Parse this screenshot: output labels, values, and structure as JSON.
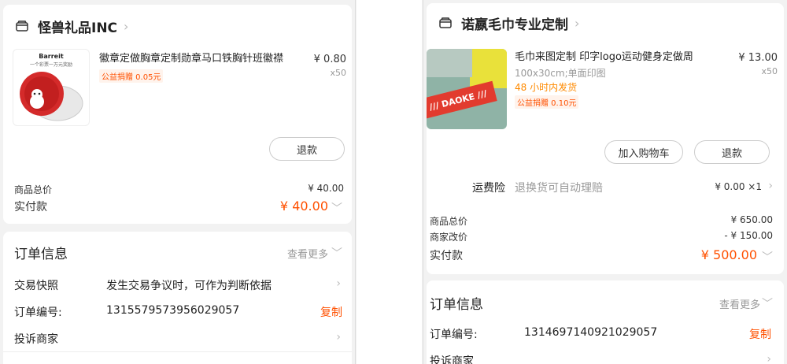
{
  "left": {
    "shop": {
      "name": "怪兽礼品INC"
    },
    "product": {
      "title": "徽章定做胸章定制勋章马口铁胸针班徽襟",
      "price": "¥ 0.80",
      "qty": "x50",
      "charity": "公益捐赠 0.05元",
      "thumb_brand": "Barreit",
      "thumb_slogan": "一个彩票一万元奖励"
    },
    "refund_button": "退款",
    "totals": {
      "goods_label": "商品总价",
      "goods_value": "¥ 40.00",
      "paid_label": "实付款",
      "paid_value": "¥ 40.00"
    },
    "order_info": {
      "title": "订单信息",
      "more": "查看更多",
      "rows": [
        {
          "label": "交易快照",
          "value": "发生交易争议时，可作为判断依据"
        },
        {
          "label": "订单编号:",
          "value": "1315579573956029057",
          "action": "复制"
        },
        {
          "label": "投诉商家",
          "value": ""
        }
      ]
    }
  },
  "right": {
    "shop": {
      "name": "诺嬴毛巾专业定制"
    },
    "product": {
      "title": "毛巾来图定制 印字logo运动健身定做周",
      "price": "¥ 13.00",
      "qty": "x50",
      "spec": "100x30cm;单面印图",
      "ship": "48 小时内发货",
      "charity": "公益捐赠 0.10元",
      "thumb_text": "/// DAOKE ///"
    },
    "add_cart_button": "加入购物车",
    "refund_button": "退款",
    "insurance": {
      "label": "运费险",
      "desc": "退换货可自动理赔",
      "value": "¥ 0.00 ×1"
    },
    "totals": {
      "goods_label": "商品总价",
      "goods_value": "¥ 650.00",
      "adjust_label": "商家改价",
      "adjust_value": "- ¥ 150.00",
      "paid_label": "实付款",
      "paid_value": "¥ 500.00"
    },
    "order_info": {
      "title": "订单信息",
      "more": "查看更多",
      "rows": [
        {
          "label": "订单编号:",
          "value": "1314697140921029057",
          "action": "复制"
        },
        {
          "label": "投诉商家",
          "value": ""
        }
      ]
    }
  },
  "colors": {
    "accent": "#ff5000",
    "muted": "#999999",
    "ship": "#ff8a00"
  }
}
